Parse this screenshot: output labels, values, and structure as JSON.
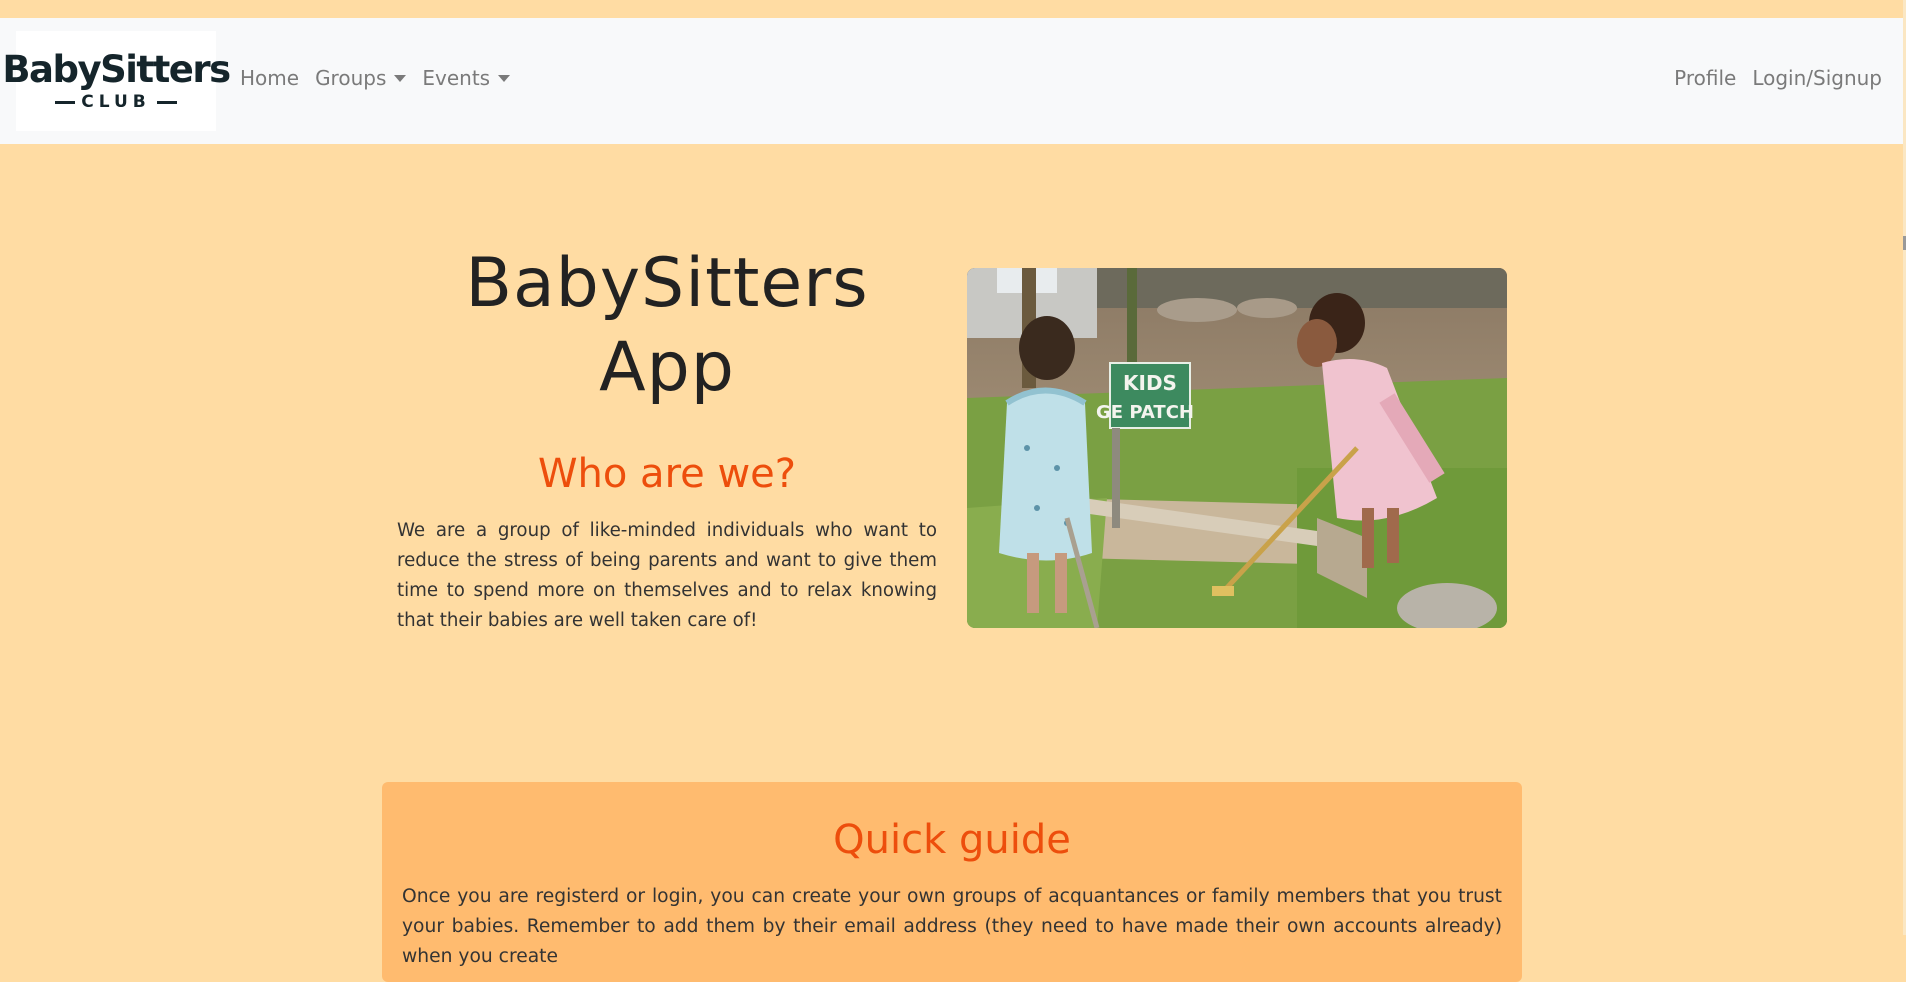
{
  "navbar": {
    "logo": {
      "main": "BabySitters",
      "sub": "CLUB"
    },
    "left_links": [
      {
        "label": "Home"
      },
      {
        "label": "Groups"
      },
      {
        "label": "Events"
      }
    ],
    "right_links": [
      {
        "label": "Profile"
      },
      {
        "label": "Login/Signup"
      }
    ]
  },
  "hero": {
    "title_line1": "BabySitters",
    "title_line2": "App",
    "who_title": "Who are we?",
    "who_text": "We are a group of like-minded individuals who want to reduce the stress of being parents and want to give them time to spend more on themselves and to relax knowing that their babies are well taken care of!",
    "image_sign_line1": "KIDS",
    "image_sign_line2": "GE PATCH"
  },
  "guide": {
    "title": "Quick guide",
    "text": "Once you are registerd or login, you can create your own groups of acquantances or family members that you trust your babies. Remember to add them by their email address (they need to have made their own accounts already) when you create"
  },
  "colors": {
    "page_bg": "#ffdca3",
    "navbar_bg": "#f8f9fa",
    "accent": "#ed4e0c",
    "guide_bg": "#ffbb6f"
  }
}
